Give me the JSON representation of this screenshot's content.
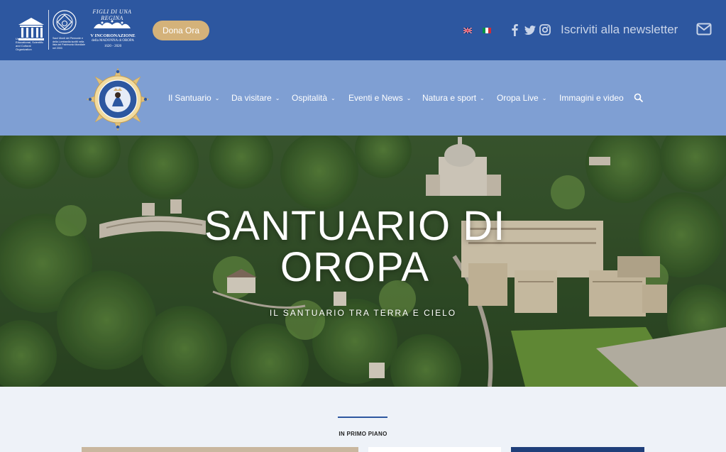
{
  "header": {
    "unesco_caption": "United Nations Educational, Scientific and Cultural Organization",
    "whs_caption": "Sacri Monti del Piemonte e della Lombardia iscritti nella lista del Patrimonio Mondiale nel 2003",
    "figli_arc": "FIGLI DI UNA REGINA",
    "figli_line1": "V INCORONAZIONE",
    "figli_line2": "della MADONNA di OROPA",
    "figli_line3": "1620 - 2020",
    "donate_label": "Dona Ora",
    "newsletter_label": "Iscriviti alla newsletter",
    "languages": [
      "en-flag-icon",
      "it-flag-icon"
    ],
    "social_icons": [
      "facebook-icon",
      "twitter-icon",
      "instagram-icon"
    ]
  },
  "nav": {
    "items": [
      {
        "label": "Il Santuario",
        "has_dropdown": true
      },
      {
        "label": "Da visitare",
        "has_dropdown": true
      },
      {
        "label": "Ospitalità",
        "has_dropdown": true
      },
      {
        "label": "Eventi e News",
        "has_dropdown": true
      },
      {
        "label": "Natura e sport",
        "has_dropdown": true
      },
      {
        "label": "Oropa Live",
        "has_dropdown": true
      },
      {
        "label": "Immagini e video",
        "has_dropdown": false
      }
    ],
    "chevron": "⌄"
  },
  "hero": {
    "title_line1": "SANTUARIO DI",
    "title_line2": "OROPA",
    "subtitle": "IL SANTUARIO TRA TERRA E CIELO"
  },
  "section": {
    "label": "IN PRIMO PIANO"
  },
  "colors": {
    "topbar": "#2d57a0",
    "navbar": "#7f9fd3",
    "accent_gold": "#d4b27a",
    "page_bg": "#eef2f8"
  }
}
